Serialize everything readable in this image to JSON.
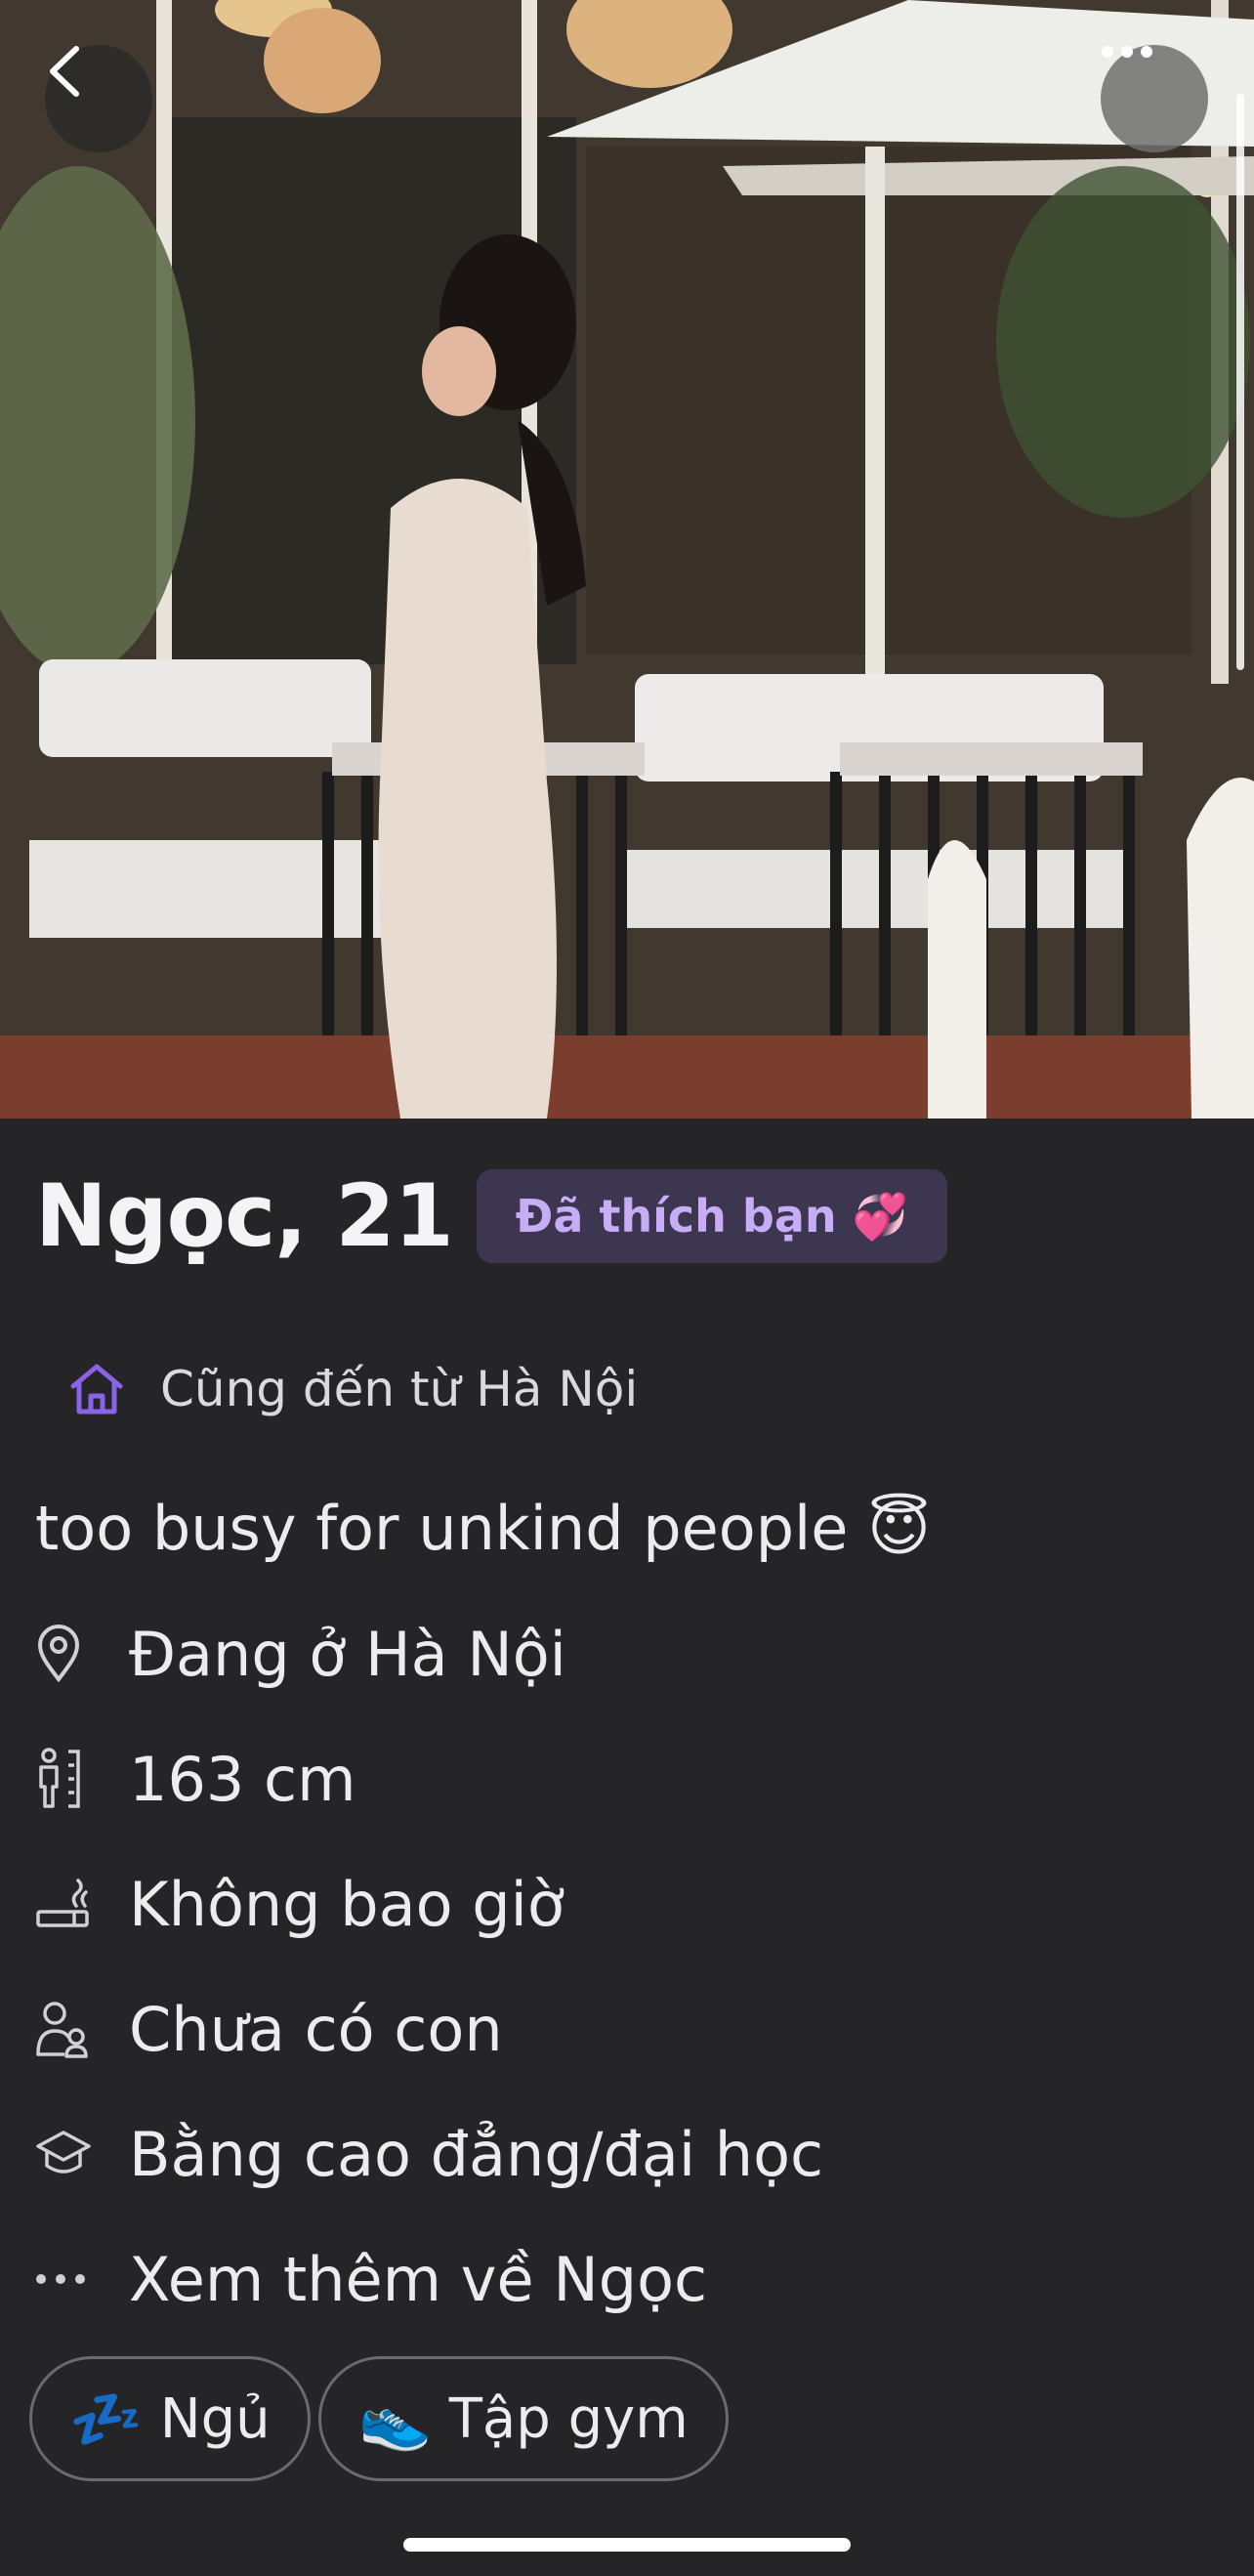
{
  "profile": {
    "name_age": "Ngọc, 21",
    "liked_badge": "Đã thích bạn 💞",
    "hometown": "Cũng đến từ Hà Nội",
    "bio": "too busy for unkind people 😇"
  },
  "attributes": [
    {
      "icon": "location-pin-icon",
      "label": "Đang ở Hà Nội"
    },
    {
      "icon": "height-icon",
      "label": "163 cm"
    },
    {
      "icon": "smoking-icon",
      "label": "Không bao giờ"
    },
    {
      "icon": "children-icon",
      "label": "Chưa có con"
    },
    {
      "icon": "education-icon",
      "label": "Bằng cao đẳng/đại học"
    },
    {
      "icon": "more-dots-icon",
      "label": "Xem thêm về Ngọc"
    }
  ],
  "interests": [
    {
      "emoji": "💤",
      "label": "Ngủ"
    },
    {
      "emoji": "👟",
      "label": "Tập gym"
    }
  ],
  "colors": {
    "background": "#252528",
    "accent_purple": "#8a63e8",
    "badge_bg": "#3c3650",
    "badge_text": "#c6adf6"
  }
}
